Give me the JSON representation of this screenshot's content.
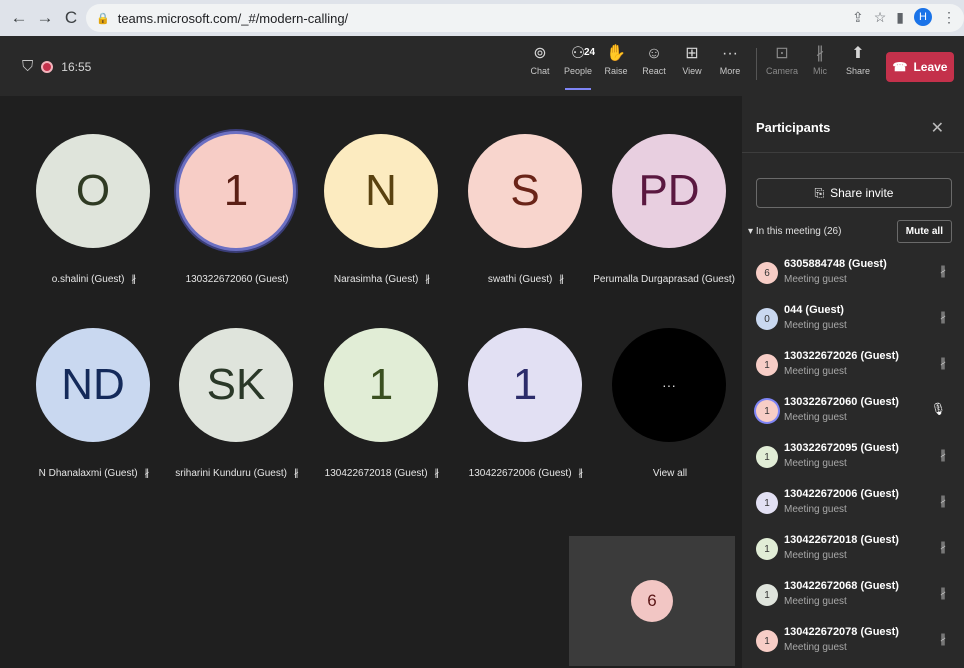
{
  "browser": {
    "back": "←",
    "forward": "→",
    "reload": "C",
    "url": "teams.microsoft.com/_#/modern-calling/",
    "profile_initial": "H"
  },
  "toolbar": {
    "timer": "16:55",
    "controls": [
      {
        "label": "Chat",
        "icon": "chat-icon",
        "glyph": "⊚"
      },
      {
        "label": "People",
        "icon": "people-icon",
        "glyph": "⚇",
        "count": "24"
      },
      {
        "label": "Raise",
        "icon": "hand-icon",
        "glyph": "✋"
      },
      {
        "label": "React",
        "icon": "smile-icon",
        "glyph": "☺"
      },
      {
        "label": "View",
        "icon": "grid-icon",
        "glyph": "⊞"
      },
      {
        "label": "More",
        "icon": "more-icon",
        "glyph": "···"
      },
      {
        "label": "Camera",
        "icon": "camera-off-icon",
        "glyph": "⊡"
      },
      {
        "label": "Mic",
        "icon": "mic-off-icon",
        "glyph": "∦"
      },
      {
        "label": "Share",
        "icon": "share-icon",
        "glyph": "⬆"
      }
    ],
    "leave_label": "Leave"
  },
  "stage": {
    "tiles": [
      {
        "initials": "O",
        "name": "o.shalini (Guest)",
        "bg": "#dfe4db",
        "fg": "#2f3a23"
      },
      {
        "initials": "1",
        "name": "130322672060 (Guest)",
        "bg": "#f7cdc6",
        "fg": "#5a1f15"
      },
      {
        "initials": "N",
        "name": "Narasimha (Guest)",
        "bg": "#fcebc0",
        "fg": "#5a4210"
      },
      {
        "initials": "S",
        "name": "swathi (Guest)",
        "bg": "#f8d5cd",
        "fg": "#6a2418"
      },
      {
        "initials": "PD",
        "name": "Perumalla Durgaprasad (Guest)",
        "bg": "#e8cfe0",
        "fg": "#5a1840"
      },
      {
        "initials": "ND",
        "name": "N Dhanalaxmi (Guest)",
        "bg": "#c9d8f0",
        "fg": "#142a5a"
      },
      {
        "initials": "SK",
        "name": "sriharini Kunduru (Guest)",
        "bg": "#dfe4dc",
        "fg": "#2a3828"
      },
      {
        "initials": "1",
        "name": "130422672018 (Guest)",
        "bg": "#e1edd6",
        "fg": "#3a5020"
      },
      {
        "initials": "1",
        "name": "130422672006 (Guest)",
        "bg": "#e2e0f3",
        "fg": "#2c2c6a"
      },
      {
        "initials": "···",
        "name": "View all",
        "bg": "#000000",
        "fg": "#dddddd"
      }
    ],
    "self_initial": "6"
  },
  "panel": {
    "title": "Participants",
    "close": "✕",
    "share_invite": "Share invite",
    "section_label": "In this meeting (26)",
    "mute_all": "Mute all",
    "participants": [
      {
        "initial": "6",
        "name": "6305884748 (Guest)",
        "role": "Meeting guest",
        "bg": "#f7cdc6",
        "mic": "off"
      },
      {
        "initial": "0",
        "name": "044 (Guest)",
        "role": "Meeting guest",
        "bg": "#c9d8f0",
        "mic": "off"
      },
      {
        "initial": "1",
        "name": "130322672026 (Guest)",
        "role": "Meeting guest",
        "bg": "#f7cdc6",
        "mic": "off"
      },
      {
        "initial": "1",
        "name": "130322672060 (Guest)",
        "role": "Meeting guest",
        "bg": "#f7cdc6",
        "mic": "on"
      },
      {
        "initial": "1",
        "name": "130322672095 (Guest)",
        "role": "Meeting guest",
        "bg": "#e1edd6",
        "mic": "off"
      },
      {
        "initial": "1",
        "name": "130422672006 (Guest)",
        "role": "Meeting guest",
        "bg": "#e2e0f3",
        "mic": "off"
      },
      {
        "initial": "1",
        "name": "130422672018 (Guest)",
        "role": "Meeting guest",
        "bg": "#e1edd6",
        "mic": "off"
      },
      {
        "initial": "1",
        "name": "130422672068 (Guest)",
        "role": "Meeting guest",
        "bg": "#dfe4dc",
        "mic": "off"
      },
      {
        "initial": "1",
        "name": "130422672078 (Guest)",
        "role": "Meeting guest",
        "bg": "#f7cdc6",
        "mic": "off"
      }
    ]
  }
}
